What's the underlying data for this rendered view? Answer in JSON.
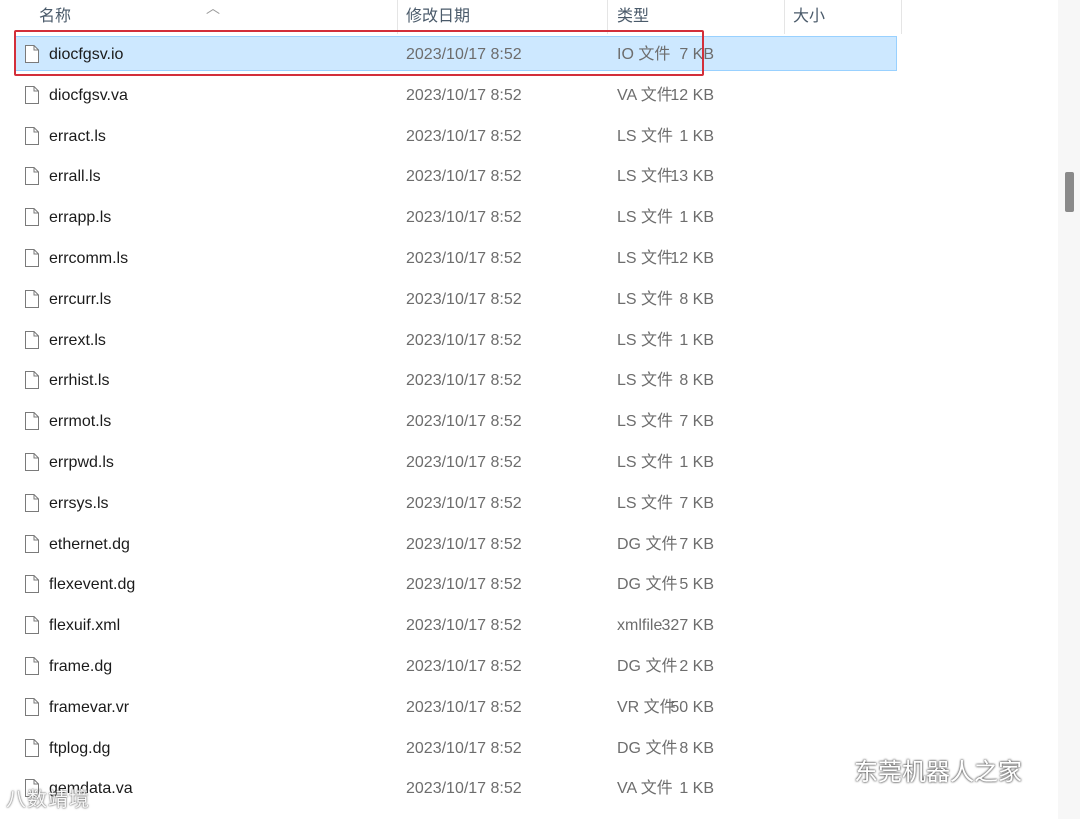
{
  "columns": {
    "name": "名称",
    "date": "修改日期",
    "type": "类型",
    "size": "大小"
  },
  "files": [
    {
      "name": "diocfgsv.io",
      "date": "2023/10/17 8:52",
      "type": "IO 文件",
      "size": "7 KB",
      "selected": true
    },
    {
      "name": "diocfgsv.va",
      "date": "2023/10/17 8:52",
      "type": "VA 文件",
      "size": "12 KB"
    },
    {
      "name": "erract.ls",
      "date": "2023/10/17 8:52",
      "type": "LS 文件",
      "size": "1 KB"
    },
    {
      "name": "errall.ls",
      "date": "2023/10/17 8:52",
      "type": "LS 文件",
      "size": "13 KB"
    },
    {
      "name": "errapp.ls",
      "date": "2023/10/17 8:52",
      "type": "LS 文件",
      "size": "1 KB"
    },
    {
      "name": "errcomm.ls",
      "date": "2023/10/17 8:52",
      "type": "LS 文件",
      "size": "12 KB"
    },
    {
      "name": "errcurr.ls",
      "date": "2023/10/17 8:52",
      "type": "LS 文件",
      "size": "8 KB"
    },
    {
      "name": "errext.ls",
      "date": "2023/10/17 8:52",
      "type": "LS 文件",
      "size": "1 KB"
    },
    {
      "name": "errhist.ls",
      "date": "2023/10/17 8:52",
      "type": "LS 文件",
      "size": "8 KB"
    },
    {
      "name": "errmot.ls",
      "date": "2023/10/17 8:52",
      "type": "LS 文件",
      "size": "7 KB"
    },
    {
      "name": "errpwd.ls",
      "date": "2023/10/17 8:52",
      "type": "LS 文件",
      "size": "1 KB"
    },
    {
      "name": "errsys.ls",
      "date": "2023/10/17 8:52",
      "type": "LS 文件",
      "size": "7 KB"
    },
    {
      "name": "ethernet.dg",
      "date": "2023/10/17 8:52",
      "type": "DG 文件",
      "size": "7 KB"
    },
    {
      "name": "flexevent.dg",
      "date": "2023/10/17 8:52",
      "type": "DG 文件",
      "size": "5 KB"
    },
    {
      "name": "flexuif.xml",
      "date": "2023/10/17 8:52",
      "type": "xmlfile",
      "size": "327 KB"
    },
    {
      "name": "frame.dg",
      "date": "2023/10/17 8:52",
      "type": "DG 文件",
      "size": "2 KB"
    },
    {
      "name": "framevar.vr",
      "date": "2023/10/17 8:52",
      "type": "VR 文件",
      "size": "50 KB"
    },
    {
      "name": "ftplog.dg",
      "date": "2023/10/17 8:52",
      "type": "DG 文件",
      "size": "8 KB"
    },
    {
      "name": "gemdata.va",
      "date": "2023/10/17 8:52",
      "type": "VA 文件",
      "size": "1 KB"
    }
  ],
  "watermark": {
    "left": "八数靖境",
    "right": "东莞机器人之家"
  },
  "colors": {
    "selection_bg": "#cde8ff",
    "selection_border": "#99d1ff",
    "highlight_box": "#d32f3a"
  }
}
